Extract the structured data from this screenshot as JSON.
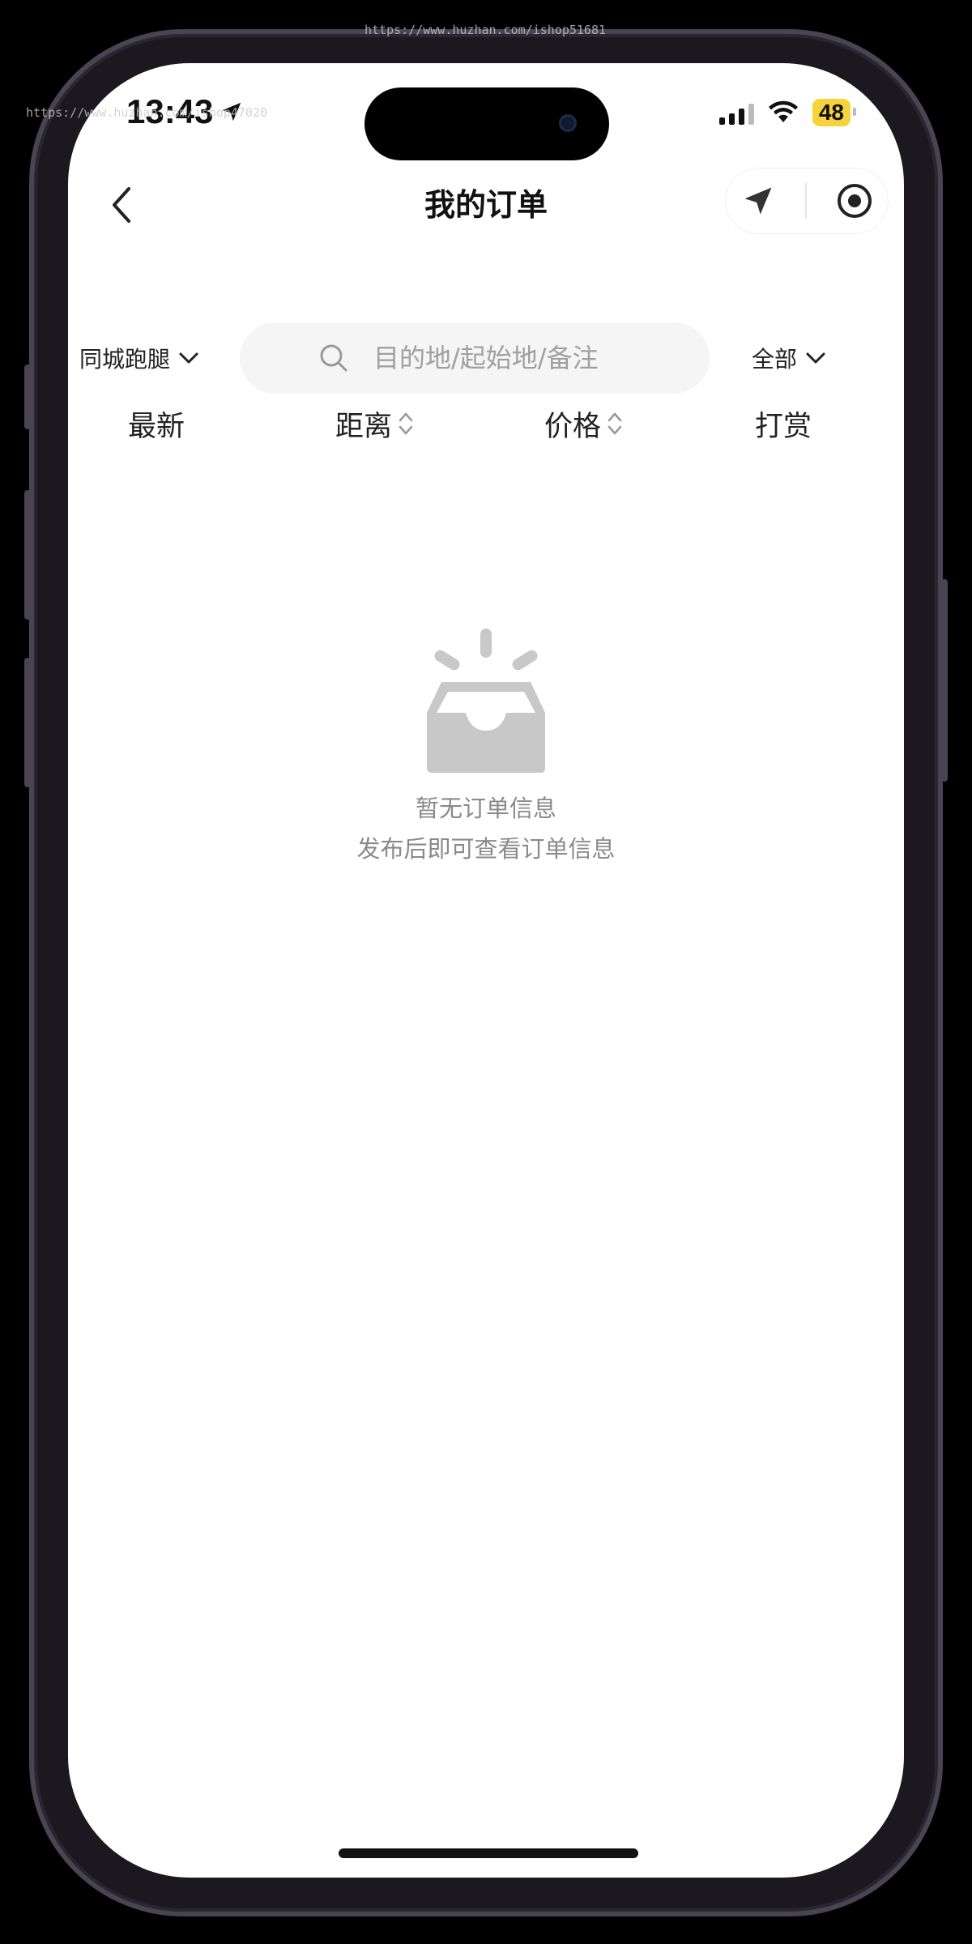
{
  "status_bar": {
    "time": "13:43",
    "battery": "48"
  },
  "watermark": {
    "top": "https://www.huzhan.com/ishop51681",
    "left": "https://www.huzhan.com/ishop47020"
  },
  "nav": {
    "title": "我的订单"
  },
  "filters": {
    "city": "同城跑腿",
    "search_placeholder": "目的地/起始地/备注",
    "scope": "全部"
  },
  "sort": {
    "latest": "最新",
    "distance": "距离",
    "price": "价格",
    "tip": "打赏"
  },
  "empty_state": {
    "title": "暂无订单信息",
    "subtitle": "发布后即可查看订单信息"
  },
  "colors": {
    "battery": "#f6d33a",
    "empty_icon": "#c8c8c8",
    "search_bg": "#f5f5f5"
  }
}
